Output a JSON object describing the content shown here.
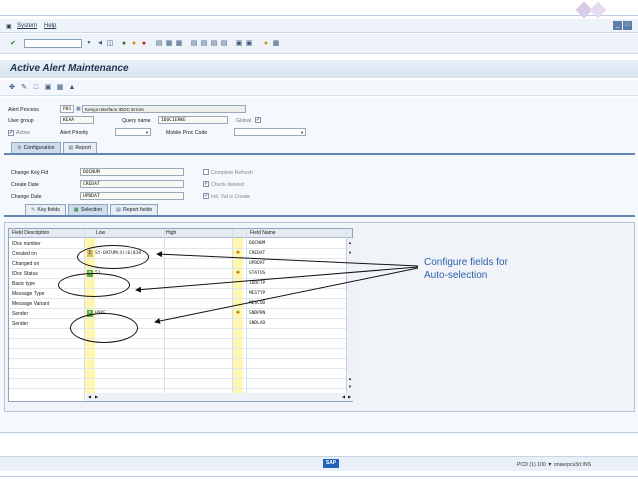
{
  "menu": {
    "system": "System",
    "help": "Help"
  },
  "window": {
    "minimize": "_",
    "restore": "□"
  },
  "page": {
    "title": "Active Alert Maintenance"
  },
  "header": {
    "alert_process_label": "Alert Process",
    "alert_process_code": "P01",
    "alert_process_desc": "Kenya Interface IDOC Errors",
    "user_group_label": "User group",
    "user_group_value": "KEAA",
    "query_name_label": "Query name",
    "query_name_value": "IDOCIERKE",
    "global_label": "Global",
    "active_label": "Active",
    "alert_priority_label": "Alert Priority",
    "mobile_proc_label": "Mobile Proc Code"
  },
  "main_tabs": [
    {
      "label": "Configuration"
    },
    {
      "label": "Report"
    }
  ],
  "config": {
    "change_key_label": "Change Key Fld",
    "change_key_value": "DOCNUM",
    "create_date_label": "Create Date",
    "create_date_value": "CREDAT",
    "change_date_label": "Change Date",
    "change_date_value": "UPDDAT",
    "complete_refresh_label": "Complete Refresh",
    "check_deleted_label": "Check deleted",
    "init_val_label": "Init. Val is Create"
  },
  "sub_tabs": [
    {
      "label": "Key fields"
    },
    {
      "label": "Selection"
    },
    {
      "label": "Report fields"
    }
  ],
  "table": {
    "headers": {
      "desc": "Field Description",
      "low": "Low",
      "high": "High",
      "field": "Field Name"
    },
    "rows": [
      {
        "desc": "IDoc number",
        "low": "",
        "field": "DOCNUM"
      },
      {
        "desc": "Created on",
        "low": "SY-DATUM(4)(6)010",
        "field": "CREDAT"
      },
      {
        "desc": "Changed on",
        "low": "",
        "field": "UPDDAT"
      },
      {
        "desc": "IDoc Status",
        "low": "51",
        "field": "STATUS"
      },
      {
        "desc": "Basic type",
        "low": "",
        "field": "IDOCTP"
      },
      {
        "desc": "Message Type",
        "low": "",
        "field": "MESTYP"
      },
      {
        "desc": "Message Variant",
        "low": "",
        "field": "MESCOD"
      },
      {
        "desc": "Sender",
        "low": "HSKE",
        "field": "SNDPRN"
      },
      {
        "desc": "Sender",
        "low": "",
        "field": "SNDLAD"
      }
    ]
  },
  "annotation": {
    "line1": "Configure fields for",
    "line2": "Auto-selection"
  },
  "status": {
    "text": "PCD (1) 100 ▼  onaerpcs3d  INS"
  },
  "icons": {
    "check": "✔",
    "dropdown": "▼",
    "star": "★",
    "arrow_left": "◀",
    "arrow_right": "▶",
    "arrow_up": "▲",
    "arrow_down": "▼"
  },
  "colors": {
    "accent": "#2e5fa6",
    "title": "#1f3350",
    "yellow_field": "#fff6b0",
    "sap_blue": "#1f62b8"
  }
}
